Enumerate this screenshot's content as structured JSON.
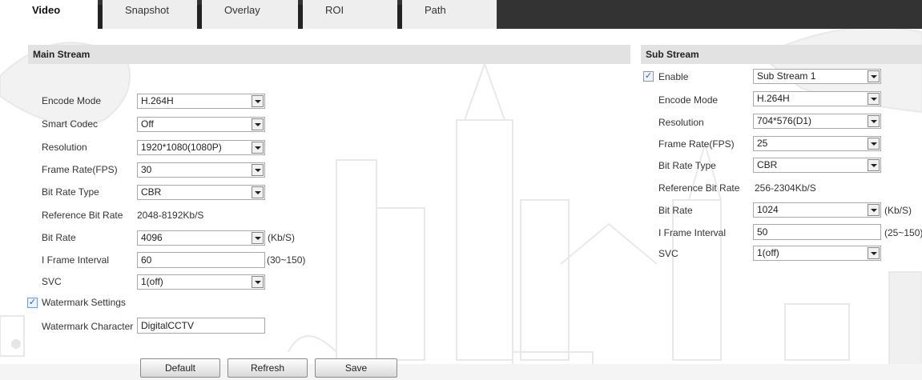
{
  "tabs": [
    "Video",
    "Snapshot",
    "Overlay",
    "ROI",
    "Path"
  ],
  "main": {
    "title": "Main Stream",
    "rows": [
      {
        "label": "Encode Mode",
        "value": "H.264H"
      },
      {
        "label": "Smart Codec",
        "value": "Off"
      },
      {
        "label": "Resolution",
        "value": "1920*1080(1080P)"
      },
      {
        "label": "Frame Rate(FPS)",
        "value": "30"
      },
      {
        "label": "Bit Rate Type",
        "value": "CBR"
      }
    ],
    "ref_bitrate_label": "Reference Bit Rate",
    "ref_bitrate_value": "2048-8192Kb/S",
    "bitrate_label": "Bit Rate",
    "bitrate_value": "4096",
    "bitrate_unit": "(Kb/S)",
    "iframe_label": "I Frame Interval",
    "iframe_value": "60",
    "iframe_range": "(30~150)",
    "svc_label": "SVC",
    "svc_value": "1(off)",
    "watermark_label": "Watermark Settings",
    "watermark_checked": true,
    "watermark_char_label": "Watermark Character",
    "watermark_char_value": "DigitalCCTV"
  },
  "sub": {
    "title": "Sub Stream",
    "enable_label": "Enable",
    "enable_checked": true,
    "enable_value": "Sub Stream 1",
    "rows": [
      {
        "label": "Encode Mode",
        "value": "H.264H"
      },
      {
        "label": "Resolution",
        "value": "704*576(D1)"
      },
      {
        "label": "Frame Rate(FPS)",
        "value": "25"
      },
      {
        "label": "Bit Rate Type",
        "value": "CBR"
      }
    ],
    "ref_bitrate_label": "Reference Bit Rate",
    "ref_bitrate_value": "256-2304Kb/S",
    "bitrate_label": "Bit Rate",
    "bitrate_value": "1024",
    "bitrate_unit": "(Kb/S)",
    "iframe_label": "I Frame Interval",
    "iframe_value": "50",
    "iframe_range": "(25~150)",
    "svc_label": "SVC",
    "svc_value": "1(off)"
  },
  "buttons": {
    "default": "Default",
    "refresh": "Refresh",
    "save": "Save"
  },
  "icons": {
    "checkbox": "check-mark-icon",
    "dropdown": "chevron-down-icon"
  }
}
